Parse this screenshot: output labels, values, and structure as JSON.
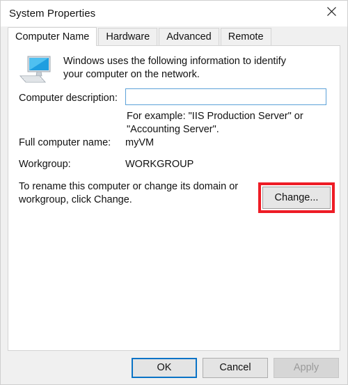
{
  "window": {
    "title": "System Properties",
    "close_icon": "close-icon"
  },
  "tabs": [
    {
      "label": "Computer Name",
      "selected": true
    },
    {
      "label": "Hardware",
      "selected": false
    },
    {
      "label": "Advanced",
      "selected": false
    },
    {
      "label": "Remote",
      "selected": false
    }
  ],
  "content": {
    "icon_name": "computer-monitor-icon",
    "intro_text": "Windows uses the following information to identify your computer on the network.",
    "description_label": "Computer description:",
    "description_value": "",
    "description_placeholder": "",
    "description_hint": "For example: \"IIS Production Server\" or \"Accounting Server\".",
    "full_name_label": "Full computer name:",
    "full_name_value": "myVM",
    "workgroup_label": "Workgroup:",
    "workgroup_value": "WORKGROUP",
    "rename_text": "To rename this computer or change its domain or workgroup, click Change.",
    "change_button_label": "Change..."
  },
  "footer": {
    "ok_label": "OK",
    "cancel_label": "Cancel",
    "apply_label": "Apply"
  },
  "colors": {
    "highlight": "#ee1c25",
    "focus_border": "#5ca1d8",
    "default_button_border": "#0a73c6"
  }
}
